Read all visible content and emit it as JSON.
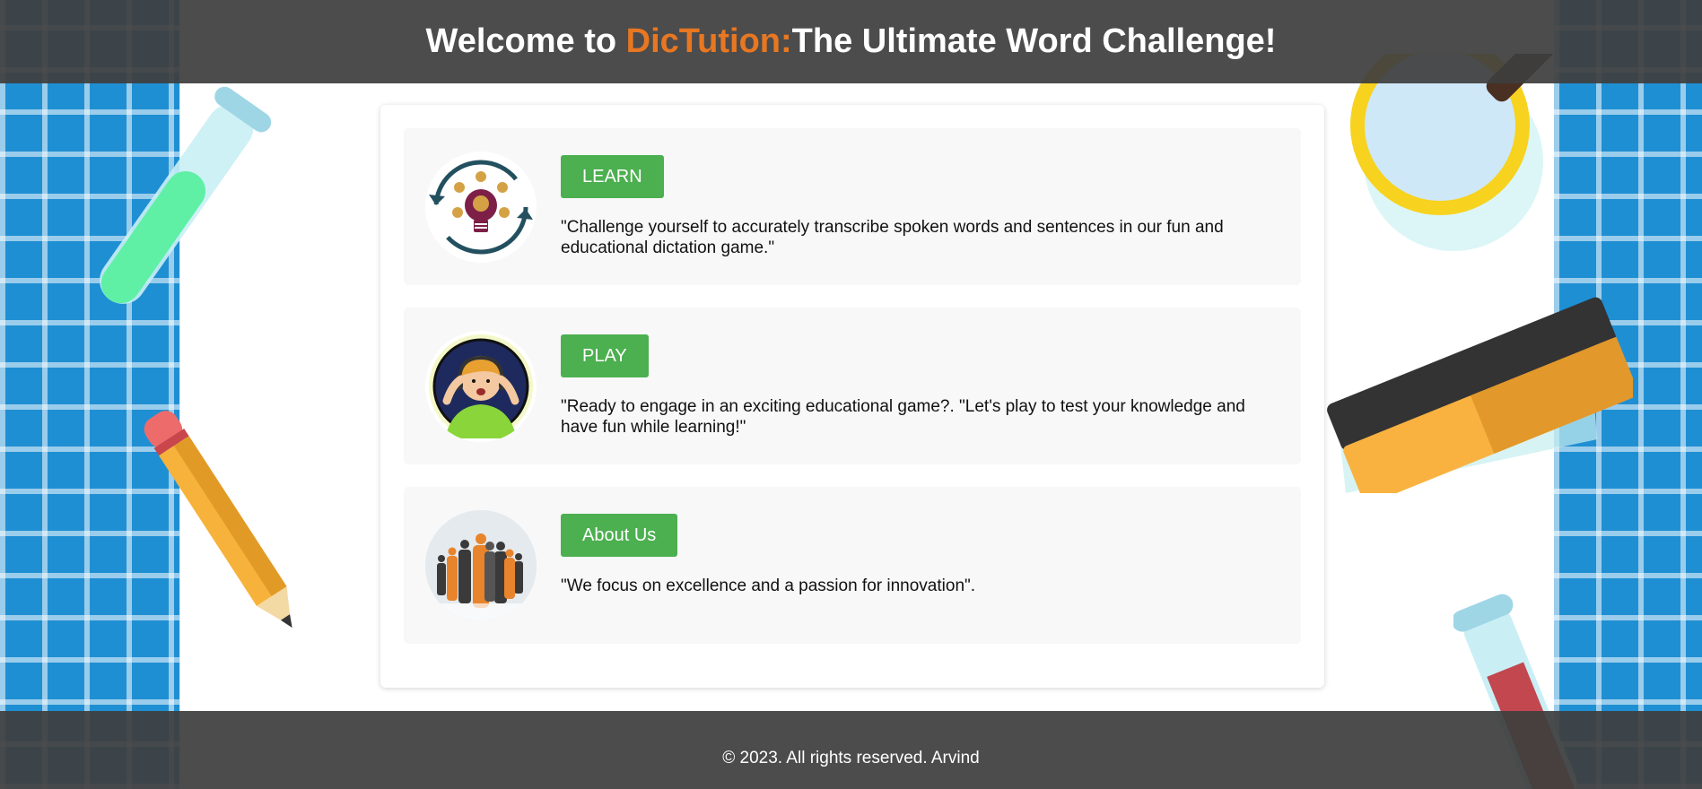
{
  "header": {
    "prefix": "Welcome to ",
    "brand": "DicTution:",
    "suffix": "The Ultimate Word Challenge!"
  },
  "sections": [
    {
      "button_label": "LEARN",
      "description": "\"Challenge yourself to accurately transcribe spoken words and sentences in our fun and educational dictation game.\"",
      "icon": "lightbulb-cycle-icon"
    },
    {
      "button_label": "PLAY",
      "description": "\"Ready to engage in an exciting educational game?. \"Let's play to test your knowledge and have fun while learning!\"",
      "icon": "child-with-headset-icon"
    },
    {
      "button_label": "About Us",
      "description": "\"We focus on excellence and a passion for innovation\".",
      "icon": "team-silhouettes-icon"
    }
  ],
  "footer": {
    "text": "© 2023. All rights reserved. Arvind"
  },
  "colors": {
    "header_bg": "#3e3e3e",
    "brand": "#e87722",
    "button": "#4caf50",
    "section_bg": "#f8f8f8",
    "grid_blue": "#1f8fd3"
  }
}
